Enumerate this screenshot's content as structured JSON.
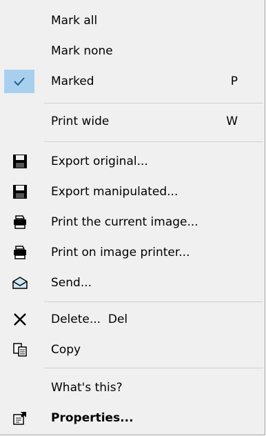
{
  "menu": {
    "mark_all": "Mark all",
    "mark_none": "Mark none",
    "marked": "Marked",
    "marked_shortcut": "P",
    "print_wide": "Print wide",
    "print_wide_shortcut": "W",
    "export_original": "Export original...",
    "export_manipulated": "Export manipulated...",
    "print_current": "Print the current image...",
    "print_image_printer": "Print on image printer...",
    "send": "Send...",
    "delete": "Delete...  Del",
    "copy": "Copy",
    "whats_this": "What's this?",
    "properties": "Properties..."
  },
  "icons": {
    "check": "checkmark-icon",
    "save": "floppy-disk-icon",
    "printer": "printer-icon",
    "mail": "envelope-icon",
    "delete": "x-delete-icon",
    "copy": "copy-icon",
    "properties": "properties-icon"
  },
  "colors": {
    "checked_bg": "#a9cfee",
    "check_mark": "#1c5f95",
    "menu_bg": "#f0f0f0"
  }
}
